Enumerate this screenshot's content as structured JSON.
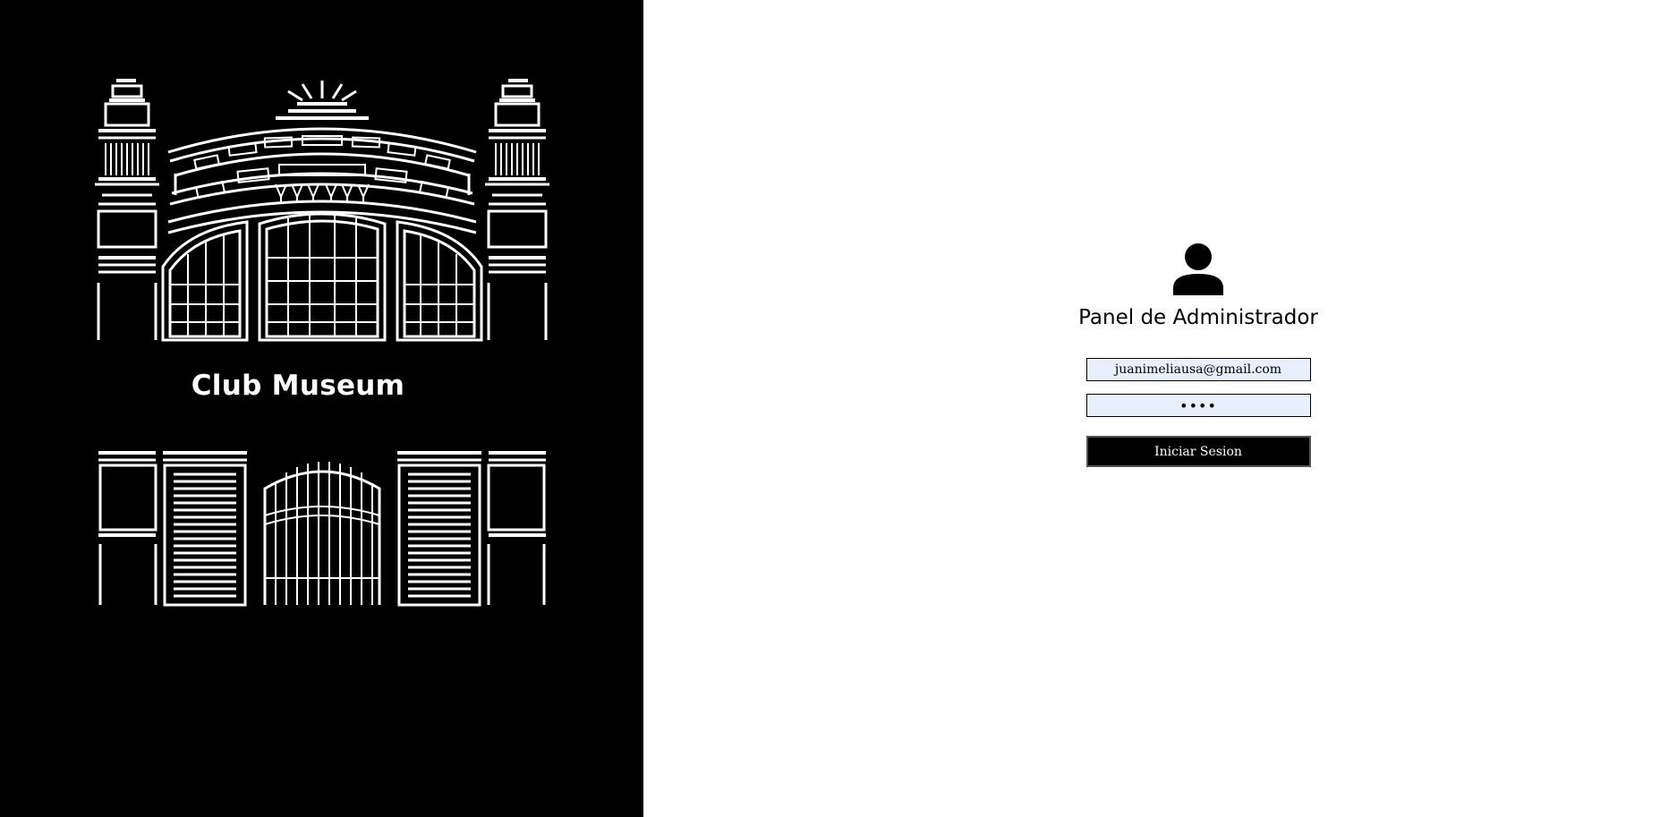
{
  "brand": {
    "title": "Club Museum",
    "logo_icon": "museum-building-icon",
    "background_color": "#000000",
    "text_color": "#ffffff"
  },
  "login": {
    "icon": "user-icon",
    "title": "Panel de Administrador",
    "email_value": "juanimeliausa@gmail.com",
    "password_value": "1234",
    "submit_label": "Iniciar Sesion",
    "field_background": "#e8f0fe",
    "button_color": "#000000"
  }
}
